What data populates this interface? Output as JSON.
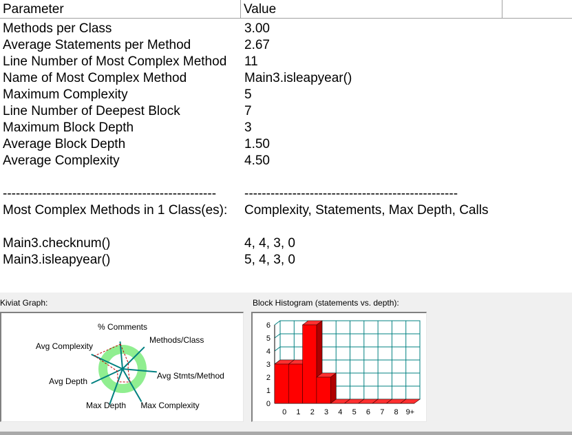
{
  "table": {
    "headers": {
      "parameter": "Parameter",
      "value": "Value"
    },
    "rows": [
      {
        "param": "Methods per Class",
        "value": "3.00"
      },
      {
        "param": "Average Statements per Method",
        "value": "2.67"
      },
      {
        "param": "Line Number of Most Complex Method",
        "value": "11"
      },
      {
        "param": "Name of Most Complex Method",
        "value": "Main3.isleapyear()"
      },
      {
        "param": "Maximum Complexity",
        "value": "5"
      },
      {
        "param": "Line Number of Deepest Block",
        "value": "7"
      },
      {
        "param": "Maximum Block Depth",
        "value": "3"
      },
      {
        "param": "Average Block Depth",
        "value": "1.50"
      },
      {
        "param": "Average Complexity",
        "value": "4.50"
      },
      {
        "param": "",
        "value": ""
      },
      {
        "param": "-------------------------------------------------",
        "value": "-------------------------------------------------"
      },
      {
        "param": "Most Complex Methods in 1 Class(es):",
        "value": "Complexity, Statements, Max Depth, Calls"
      },
      {
        "param": "",
        "value": ""
      },
      {
        "param": "Main3.checknum()",
        "value": "4, 4, 3, 0"
      },
      {
        "param": "Main3.isleapyear()",
        "value": "5, 4, 3, 0"
      }
    ]
  },
  "kiviat": {
    "label": "Kiviat Graph:",
    "axes": [
      "% Comments",
      "Methods/Class",
      "Avg Stmts/Method",
      "Max Complexity",
      "Max Depth",
      "Avg Depth",
      "Avg Complexity"
    ],
    "colors": {
      "ring": "#90ee90",
      "axis": "#008080",
      "plot": "#c00000"
    }
  },
  "histogram": {
    "label": "Block Histogram (statements vs. depth):",
    "chart_data": {
      "type": "bar",
      "categories": [
        "0",
        "1",
        "2",
        "3",
        "4",
        "5",
        "6",
        "7",
        "8",
        "9+"
      ],
      "values": [
        3,
        3,
        6,
        2,
        0,
        0,
        0,
        0,
        0,
        0
      ],
      "y_ticks": [
        "0",
        "1",
        "2",
        "3",
        "4",
        "5",
        "6"
      ],
      "ylim": [
        0,
        6
      ],
      "grid": true,
      "bar_color": "#ff0000",
      "grid_color": "#008080"
    }
  }
}
